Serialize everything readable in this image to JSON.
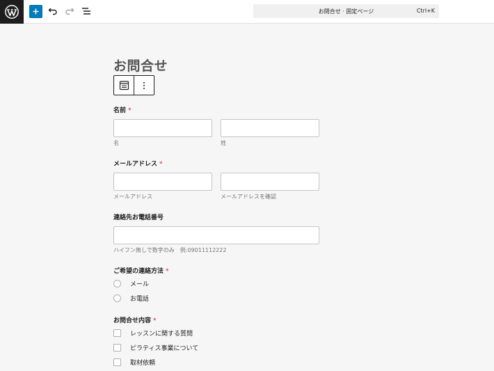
{
  "toolbar": {
    "logo_icon": "wordpress-logo",
    "add_icon": "plus-icon",
    "undo_icon": "undo-icon",
    "redo_icon": "redo-icon",
    "outline_icon": "list-view-icon",
    "command_bar": {
      "title": "お問合せ · 固定ページ",
      "shortcut": "Ctrl+K"
    },
    "accent_color": "#007cba"
  },
  "page": {
    "title": "お問合せ"
  },
  "block_toolbar": {
    "form_icon": "form-block-icon",
    "more_icon": "more-vertical-icon"
  },
  "form": {
    "required_mark": "*",
    "name": {
      "label": "名前",
      "first_sub": "名",
      "last_sub": "姓"
    },
    "email": {
      "label": "メールアドレス",
      "sub": "メールアドレス",
      "confirm_sub": "メールアドレスを確認"
    },
    "phone": {
      "label": "連絡先お電話番号",
      "sub": "ハイフン無しで数字のみ　例:09011112222"
    },
    "contact_method": {
      "label": "ご希望の連絡方法",
      "options": [
        "メール",
        "お電話"
      ]
    },
    "inquiry": {
      "label": "お問合せ内容",
      "options": [
        "レッスンに関する質問",
        "ピラティス事業について",
        "取材依頼"
      ]
    }
  }
}
